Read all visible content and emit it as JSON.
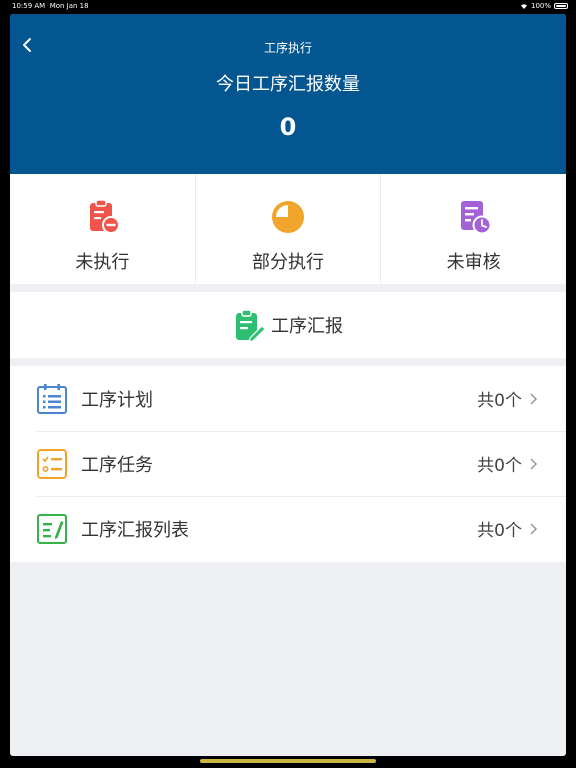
{
  "status_bar": {
    "time": "10:59 AM",
    "date": "Mon Jan 18",
    "battery": "100%"
  },
  "header": {
    "title": "工序执行",
    "today_label": "今日工序汇报数量",
    "today_count": "0"
  },
  "status_tiles": [
    {
      "label": "未执行",
      "icon": "clipboard-minus-icon",
      "color": "#f0544a"
    },
    {
      "label": "部分执行",
      "icon": "pie-chart-icon",
      "color": "#f1a42a"
    },
    {
      "label": "未审核",
      "icon": "document-clock-icon",
      "color": "#a362d6"
    }
  ],
  "report": {
    "label": "工序汇报",
    "icon": "clipboard-edit-icon",
    "color": "#2fbf72"
  },
  "list": [
    {
      "label": "工序计划",
      "count": "共0个",
      "icon": "calendar-list-icon",
      "color": "#4a86cf"
    },
    {
      "label": "工序任务",
      "count": "共0个",
      "icon": "task-checklist-icon",
      "color": "#f1a42a"
    },
    {
      "label": "工序汇报列表",
      "count": "共0个",
      "icon": "report-edit-icon",
      "color": "#35b24a"
    }
  ]
}
